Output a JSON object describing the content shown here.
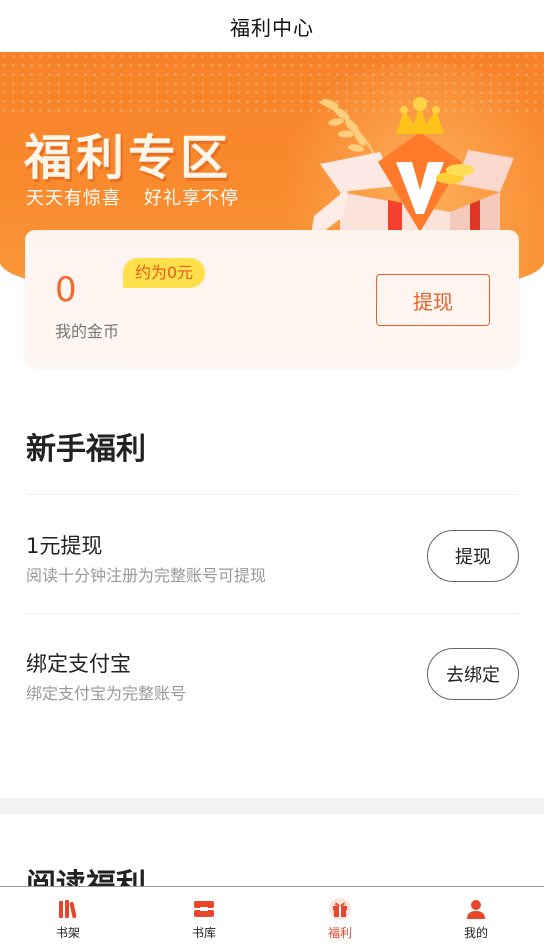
{
  "header": {
    "title": "福利中心"
  },
  "banner": {
    "headline": "福利专区",
    "slogan_left": "天天有惊喜",
    "slogan_right": "好礼享不停"
  },
  "coin_card": {
    "coins": "0",
    "estimate": "约为0元",
    "label": "我的金币",
    "withdraw_label": "提现"
  },
  "newbie": {
    "title": "新手福利",
    "tasks": [
      {
        "title": "1元提现",
        "desc": "阅读十分钟注册为完整账号可提现",
        "button": "提现"
      },
      {
        "title": "绑定支付宝",
        "desc": "绑定支付宝为完整账号",
        "button": "去绑定"
      }
    ]
  },
  "reading": {
    "title": "阅读福利"
  },
  "tabbar": {
    "items": [
      {
        "label": "书架",
        "icon": "bookshelf-icon"
      },
      {
        "label": "书库",
        "icon": "library-icon"
      },
      {
        "label": "福利",
        "icon": "gift-icon",
        "active": true
      },
      {
        "label": "我的",
        "icon": "user-icon"
      }
    ]
  },
  "colors": {
    "accent": "#e8622b",
    "banner_orange": "#f7822a",
    "estimate_yellow": "#ffe04a",
    "tab_active": "#e8462b"
  }
}
